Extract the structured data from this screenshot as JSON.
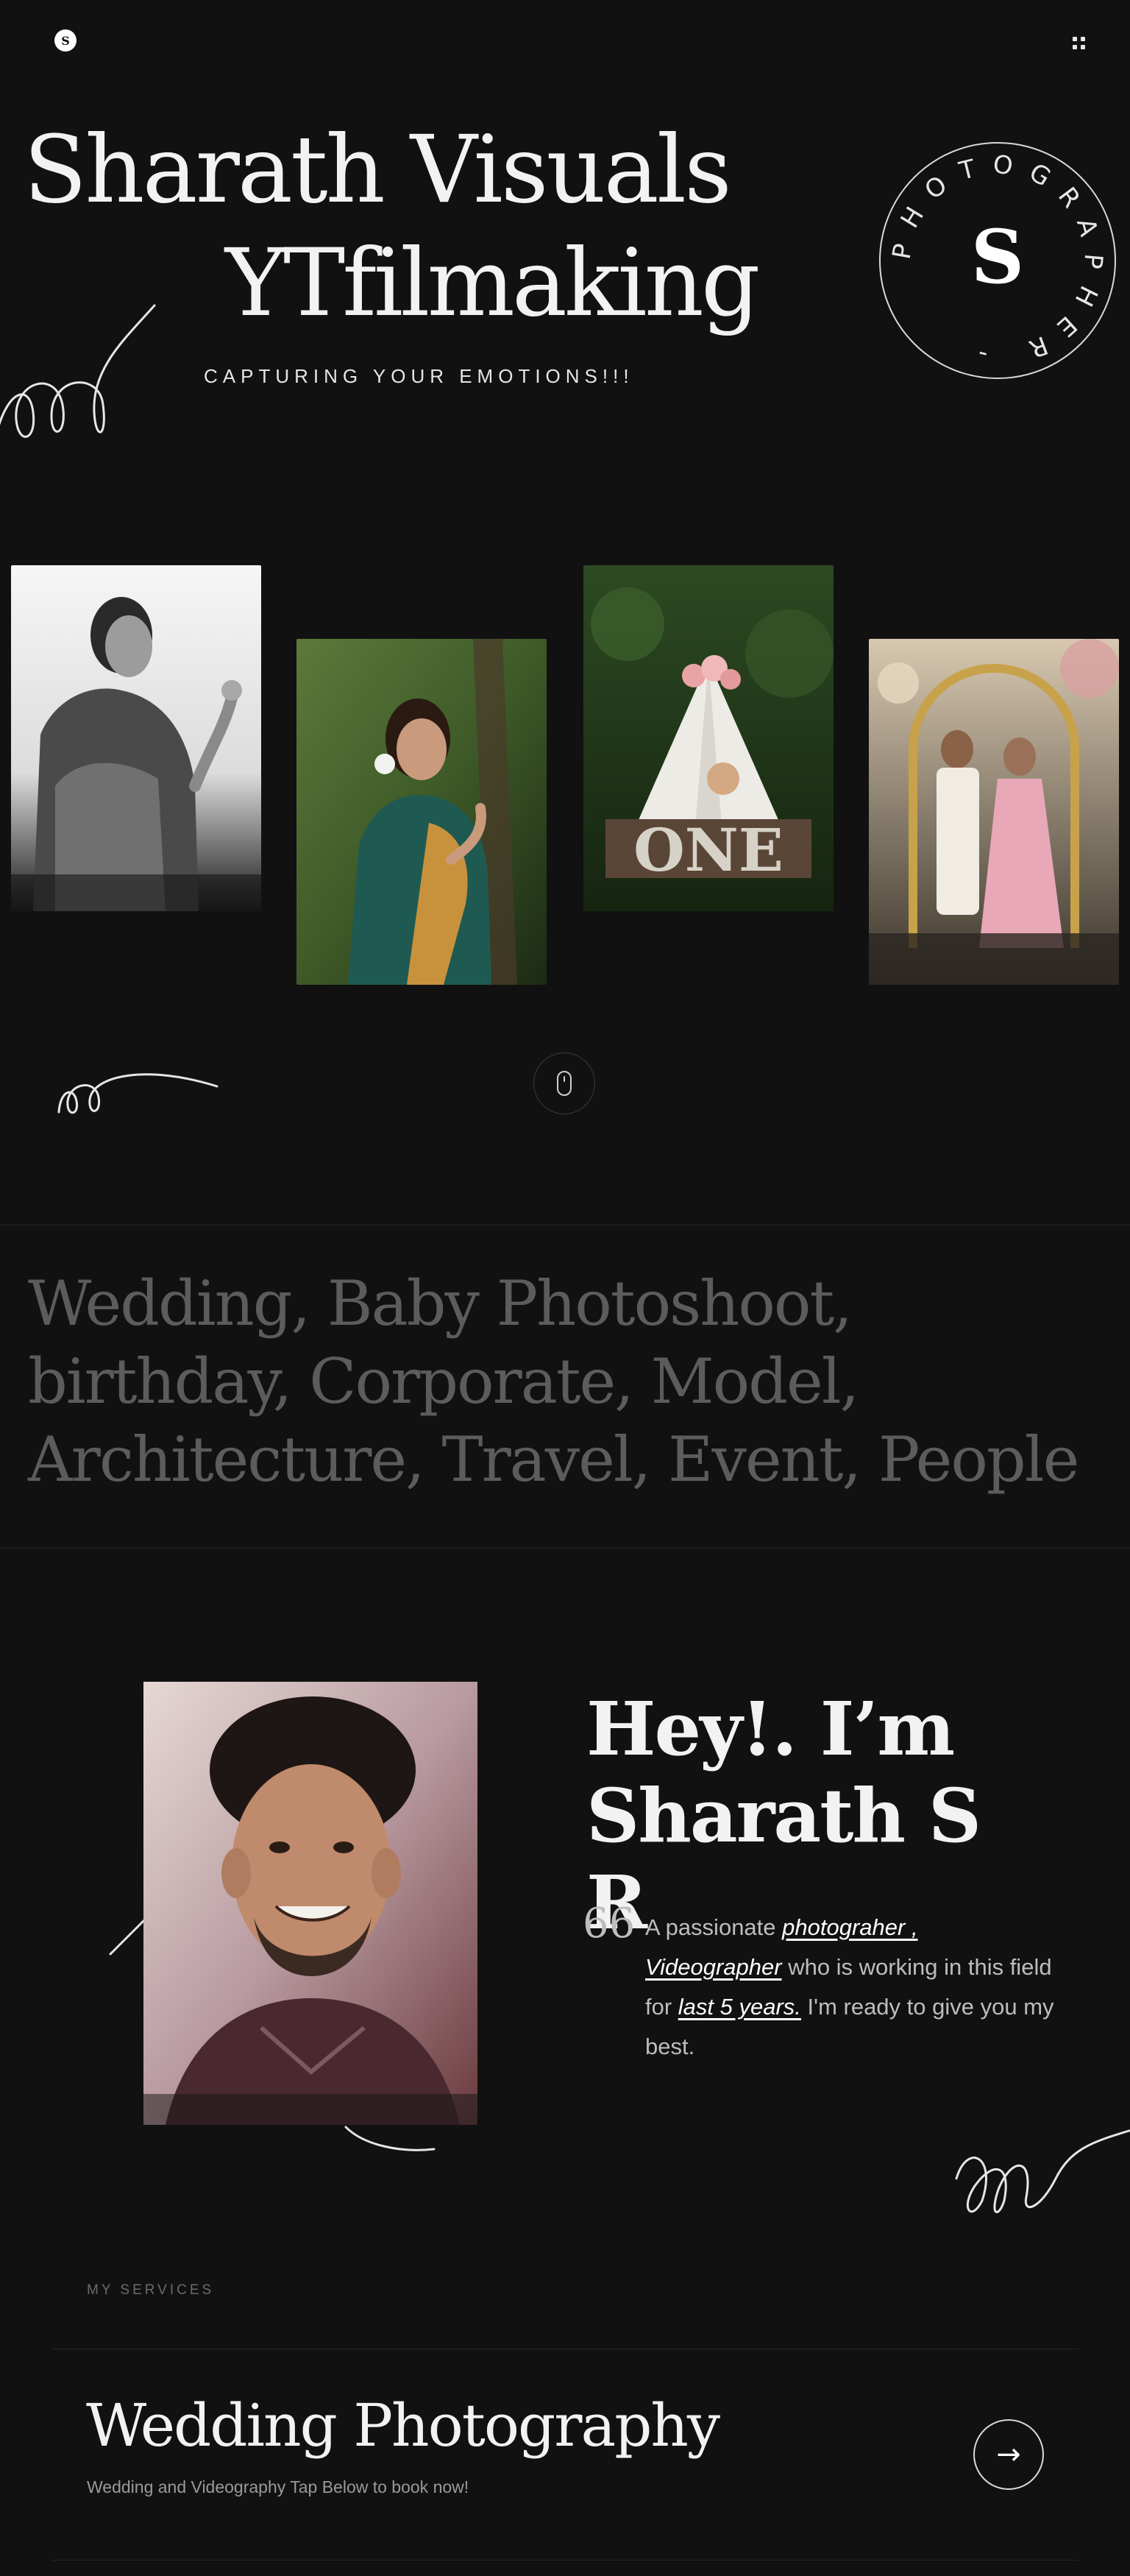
{
  "header": {
    "logo_letter": "S",
    "menu_icon": "grid-dots-icon"
  },
  "hero": {
    "title": "Sharath Visuals",
    "subtitle": "YTfilmaking",
    "tagline": "CAPTURING YOUR EMOTIONS!!!",
    "badge": {
      "ring_text": "PHOTOGRAPHER - ",
      "center_letter": "S"
    }
  },
  "gallery": {
    "photos": [
      "bw-bride-portrait",
      "bride-green-saree-portrait",
      "baby-one-teepee",
      "couple-wedding-stage"
    ]
  },
  "scroll": {
    "icon": "mouse-scroll-icon"
  },
  "categories": {
    "text": "Wedding, Baby Photoshoot, birthday, Corporate, Model, Architecture, Travel, Event, People"
  },
  "about": {
    "title_line1": "Hey!. I’m",
    "title_line2": "Sharath S R",
    "quote_mark": "66",
    "text_1": "A passionate ",
    "link_1": "photograher ,",
    "link_2": "Videographer",
    "text_2": " who is working in this field for ",
    "link_3": "last 5 years.",
    "text_3": " I'm ready to give you my best."
  },
  "services": {
    "label": "MY SERVICES",
    "items": [
      {
        "title": "Wedding Photography",
        "description": "Wedding and Videography Tap Below to book now!",
        "arrow": "→"
      }
    ]
  },
  "colors": {
    "background": "#111111",
    "text": "#f2f2f2",
    "muted": "#5c5c5c",
    "divider": "#262626"
  }
}
